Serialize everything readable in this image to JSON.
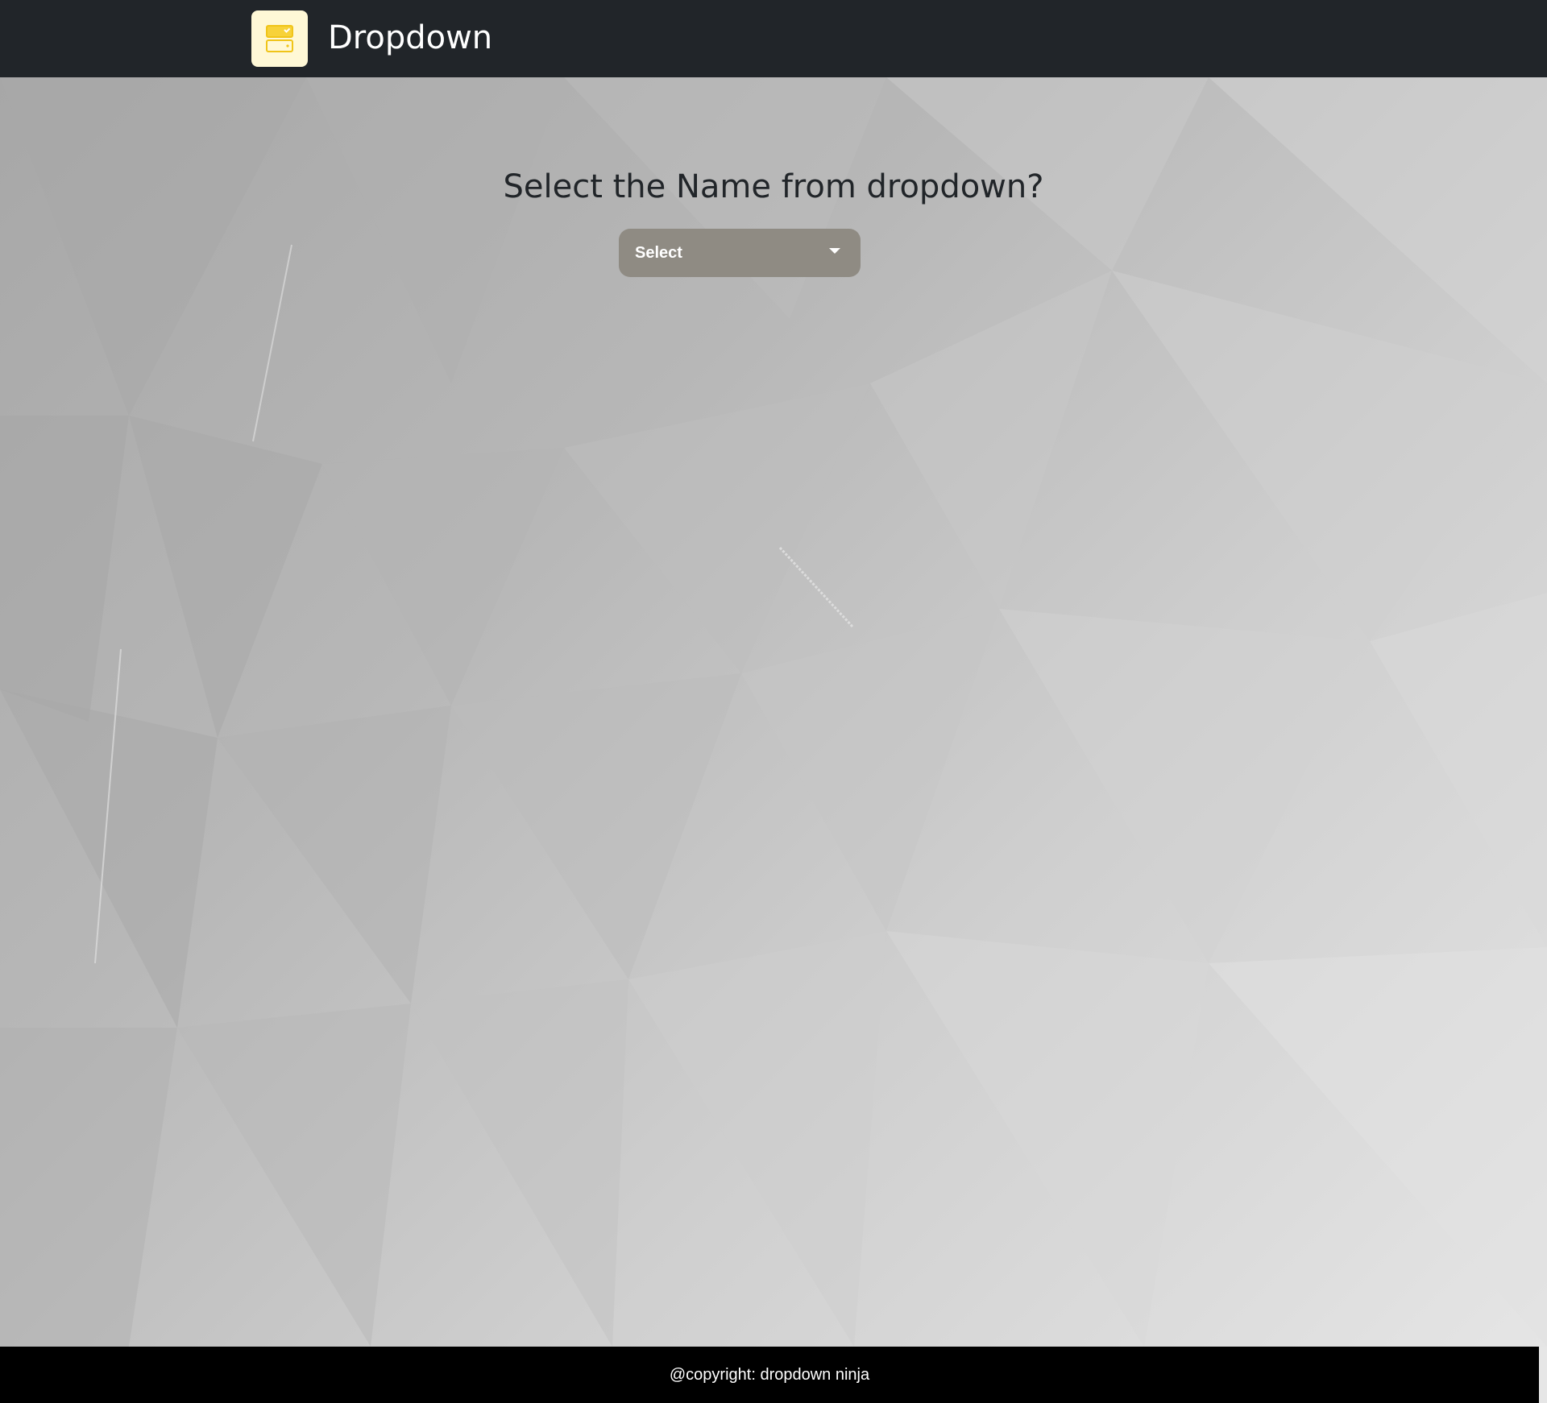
{
  "header": {
    "logo_icon": "drawer-icon",
    "title": "Dropdown"
  },
  "main": {
    "question": "Select the Name from dropdown?",
    "dropdown": {
      "selected_label": "Select",
      "caret_icon": "caret-down-icon"
    }
  },
  "footer": {
    "copyright": "@copyright: dropdown ninja"
  },
  "colors": {
    "header_bg": "#212529",
    "logo_bg": "#fff8d6",
    "logo_accent": "#f4c430",
    "dropdown_bg": "#8f8b83",
    "footer_bg": "#000000",
    "title_text": "#212529"
  }
}
